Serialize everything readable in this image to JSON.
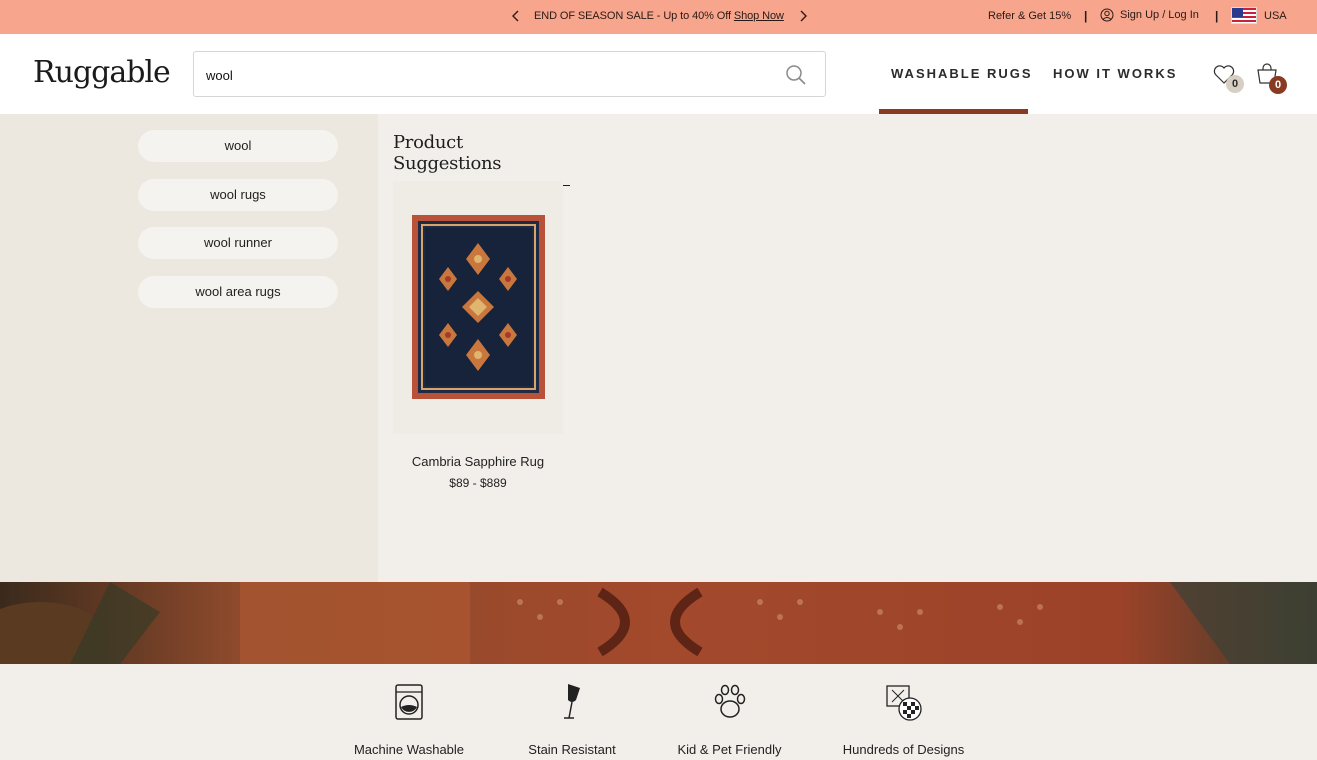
{
  "announcement": {
    "promo_text": "END OF SEASON SALE - Up to 40% Off",
    "promo_link": "Shop Now",
    "refer": "Refer & Get 15%",
    "separator": "|",
    "login": "Sign Up / Log In",
    "country": "USA"
  },
  "header": {
    "logo": "Ruggable",
    "search_value": "wool",
    "nav": [
      "WASHABLE RUGS",
      "HOW IT WORKS"
    ],
    "wishlist_count": "0",
    "cart_count": "0"
  },
  "suggestions": {
    "terms": [
      "wool",
      "wool rugs",
      "wool runner",
      "wool area rugs"
    ]
  },
  "product_suggestions": {
    "title": "Product Suggestions",
    "products": [
      {
        "name": "Cambria Sapphire Rug",
        "price": "$89 - $889"
      }
    ]
  },
  "features": [
    {
      "label": "Machine Washable",
      "icon": "washing-machine-icon"
    },
    {
      "label": "Stain Resistant",
      "icon": "wine-glass-icon"
    },
    {
      "label": "Kid & Pet Friendly",
      "icon": "paw-icon"
    },
    {
      "label": "Hundreds of Designs",
      "icon": "rug-pattern-icon"
    }
  ],
  "colors": {
    "announcement_bg": "#f7a58d",
    "accent": "#8a3a23",
    "panel_bg": "#f2efea",
    "suggest_bg": "#ece8df"
  }
}
